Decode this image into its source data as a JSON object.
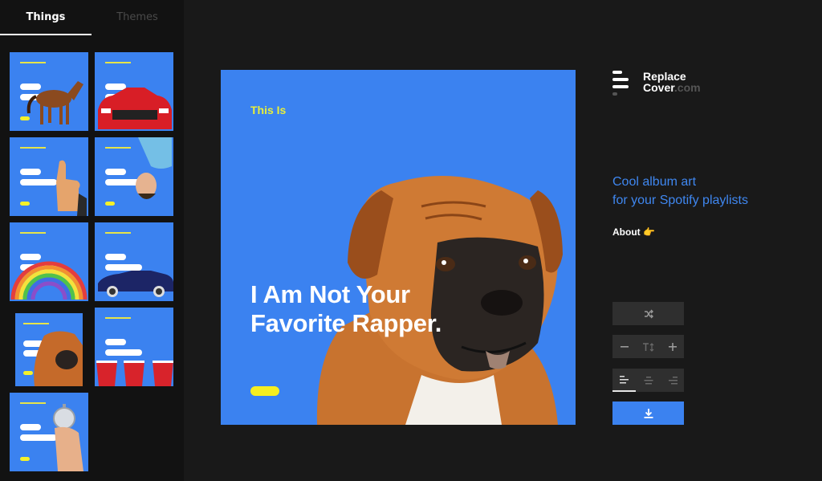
{
  "tabs": {
    "things": "Things",
    "themes": "Themes"
  },
  "thumbnails": [
    {
      "subject": "horse"
    },
    {
      "subject": "red car"
    },
    {
      "subject": "thumbs up"
    },
    {
      "subject": "upside-down man"
    },
    {
      "subject": "rainbow"
    },
    {
      "subject": "convertible car"
    },
    {
      "subject": "boxer dog"
    },
    {
      "subject": "red cups"
    },
    {
      "subject": "stopwatch"
    }
  ],
  "cover": {
    "eyebrow": "This Is",
    "title_line1": "I Am Not Your",
    "title_line2": "Favorite Rapper."
  },
  "logo": {
    "line1": "Replace",
    "line2": "Cover",
    "domain": ".com"
  },
  "tagline": {
    "line1": "Cool album art",
    "line2": "for your Spotify playlists"
  },
  "about": {
    "label": "About",
    "emoji": "👉"
  },
  "controls": {
    "shuffle_icon": "shuffle-icon",
    "minus_icon": "minus-icon",
    "text_size_icon": "text-size-icon",
    "plus_icon": "plus-icon",
    "align_left_icon": "align-left-icon",
    "align_center_icon": "align-center-icon",
    "align_right_icon": "align-right-icon",
    "download_icon": "download-icon"
  },
  "colors": {
    "accent_blue": "#3b82f0",
    "highlight_yellow": "#f6ee1f",
    "tagline_blue": "#3f87f0",
    "background": "#191919",
    "sidebar": "#121212"
  }
}
